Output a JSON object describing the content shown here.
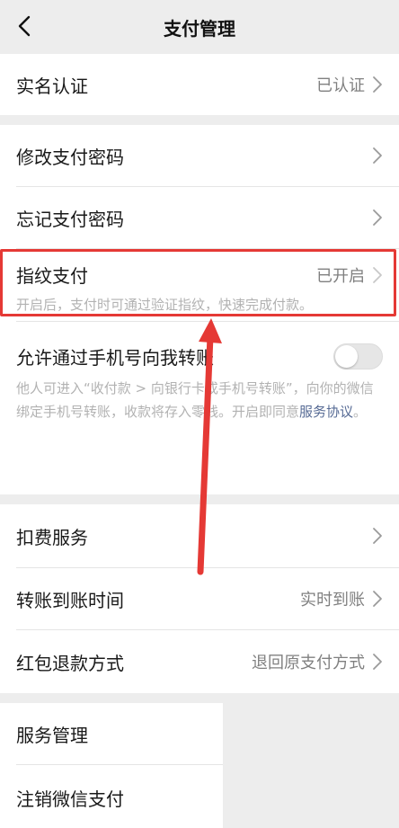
{
  "navbar": {
    "title": "支付管理",
    "back_icon": "chevron-left-icon"
  },
  "rows": {
    "real_name": {
      "label": "实名认证",
      "value": "已认证"
    },
    "modify_password": {
      "label": "修改支付密码"
    },
    "forgot_password": {
      "label": "忘记支付密码"
    },
    "fingerprint": {
      "label": "指纹支付",
      "value": "已开启",
      "desc": "开启后，支付时可通过验证指纹，快速完成付款。"
    },
    "phone_transfer": {
      "label": "允许通过手机号向我转账",
      "desc_1": "他人可进入“收付款 > 向银行卡或手机号转账”，向你的微信绑定手机号转账，收款将存入零钱。开启即同意",
      "desc_link": "服务协议",
      "desc_end": "。",
      "enabled": false
    },
    "deduction": {
      "label": "扣费服务"
    },
    "transfer_time": {
      "label": "转账到账时间",
      "value": "实时到账"
    },
    "red_packet_refund": {
      "label": "红包退款方式",
      "value": "退回原支付方式"
    },
    "service_manage": {
      "label": "服务管理"
    },
    "cancel_pay": {
      "label": "注销微信支付"
    }
  },
  "annotation": {
    "highlight_color": "#e53935",
    "arrow_color": "#e53935"
  }
}
